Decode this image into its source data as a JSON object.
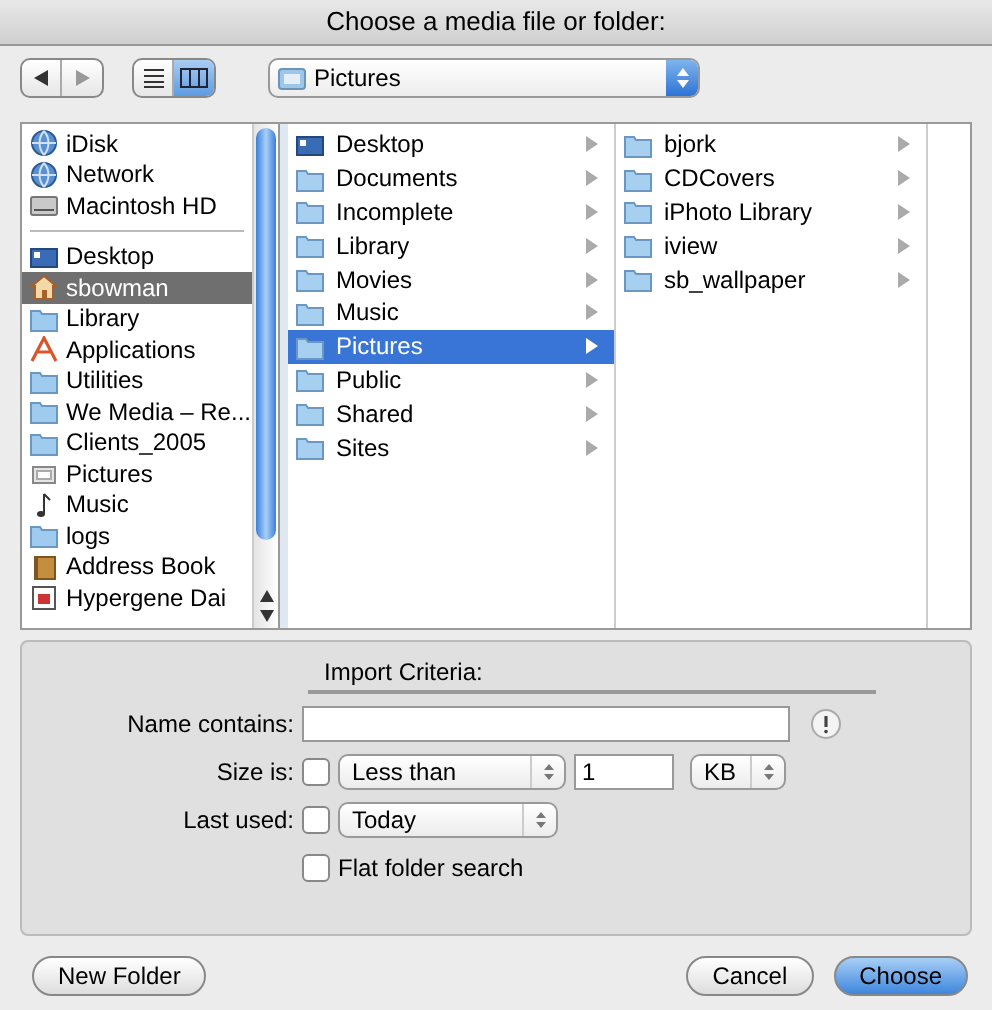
{
  "window": {
    "title": "Choose a media file or folder:"
  },
  "toolbar": {
    "view_modes": [
      {
        "kind": "list",
        "selected": false
      },
      {
        "kind": "columns",
        "selected": true
      }
    ],
    "location": "Pictures"
  },
  "sidebar": {
    "devices": [
      {
        "label": "iDisk",
        "kind": "globe",
        "selected": false
      },
      {
        "label": "Network",
        "kind": "globe",
        "selected": false
      },
      {
        "label": "Macintosh HD",
        "kind": "drive",
        "selected": false
      }
    ],
    "places": [
      {
        "label": "Desktop",
        "kind": "desktop",
        "selected": false
      },
      {
        "label": "sbowman",
        "kind": "home",
        "selected": true
      },
      {
        "label": "Library",
        "kind": "folder",
        "selected": false
      },
      {
        "label": "Applications",
        "kind": "app",
        "selected": false
      },
      {
        "label": "Utilities",
        "kind": "folder",
        "selected": false
      },
      {
        "label": "We Media – Re...",
        "kind": "folder",
        "selected": false
      },
      {
        "label": "Clients_2005",
        "kind": "folder",
        "selected": false
      },
      {
        "label": "Pictures",
        "kind": "picture",
        "selected": false
      },
      {
        "label": "Music",
        "kind": "music",
        "selected": false
      },
      {
        "label": "logs",
        "kind": "folder",
        "selected": false
      },
      {
        "label": "Address Book",
        "kind": "book",
        "selected": false
      },
      {
        "label": "Hypergene Dai",
        "kind": "document",
        "selected": false
      }
    ]
  },
  "columns": [
    [
      {
        "label": "Desktop",
        "kind": "desktop",
        "selected": false
      },
      {
        "label": "Documents",
        "kind": "folder",
        "selected": false
      },
      {
        "label": "Incomplete",
        "kind": "folder",
        "selected": false
      },
      {
        "label": "Library",
        "kind": "folder",
        "selected": false
      },
      {
        "label": "Movies",
        "kind": "folder",
        "selected": false
      },
      {
        "label": "Music",
        "kind": "folder",
        "selected": false
      },
      {
        "label": "Pictures",
        "kind": "folder",
        "selected": true
      },
      {
        "label": "Public",
        "kind": "folder",
        "selected": false
      },
      {
        "label": "Shared",
        "kind": "folder",
        "selected": false
      },
      {
        "label": "Sites",
        "kind": "folder",
        "selected": false
      }
    ],
    [
      {
        "label": "bjork",
        "kind": "folder",
        "selected": false
      },
      {
        "label": "CDCovers",
        "kind": "folder",
        "selected": false
      },
      {
        "label": "iPhoto Library",
        "kind": "folder",
        "selected": false
      },
      {
        "label": "iview",
        "kind": "folder",
        "selected": false
      },
      {
        "label": "sb_wallpaper",
        "kind": "folder",
        "selected": false
      }
    ]
  ],
  "criteria": {
    "title": "Import Criteria:",
    "name": {
      "label": "Name contains:"
    },
    "size": {
      "label": "Size is:",
      "checked": false,
      "comparison": "Less than",
      "value": "1",
      "unit": "KB"
    },
    "last_used": {
      "label": "Last used:",
      "checked": false,
      "period": "Today"
    },
    "flat": {
      "label": "Flat folder search",
      "checked": false
    }
  },
  "buttons": {
    "new_folder": "New Folder",
    "cancel": "Cancel",
    "choose": "Choose"
  }
}
